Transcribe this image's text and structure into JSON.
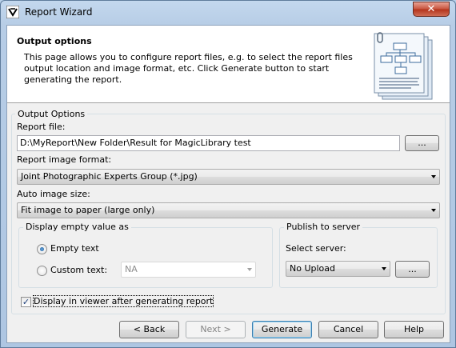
{
  "window": {
    "title": "Report Wizard",
    "close_glyph": "✕"
  },
  "header": {
    "title": "Output options",
    "description": "This page allows you to configure report files, e.g. to select the report files output location and image format, etc. Click Generate button to start generating the report."
  },
  "output_options": {
    "legend": "Output Options",
    "report_file_label": "Report file:",
    "report_file_value": "D:\\MyReport\\New Folder\\Result for MagicLibrary test",
    "browse_label": "...",
    "image_format_label": "Report image format:",
    "image_format_value": "Joint Photographic Experts Group (*.jpg)",
    "auto_size_label": "Auto image size:",
    "auto_size_value": "Fit image to paper (large only)"
  },
  "empty_value": {
    "legend": "Display empty value as",
    "empty_text_label": "Empty text",
    "custom_text_label": "Custom text:",
    "custom_text_value": "NA",
    "selected": "empty_text"
  },
  "publish": {
    "legend": "Publish to server",
    "select_server_label": "Select server:",
    "server_value": "No Upload",
    "browse_label": "..."
  },
  "display_in_viewer": {
    "label": "Display in viewer after generating report",
    "checked": true,
    "check_glyph": "✓"
  },
  "buttons": {
    "back": "< Back",
    "next": "Next >",
    "generate": "Generate",
    "cancel": "Cancel",
    "help": "Help"
  }
}
